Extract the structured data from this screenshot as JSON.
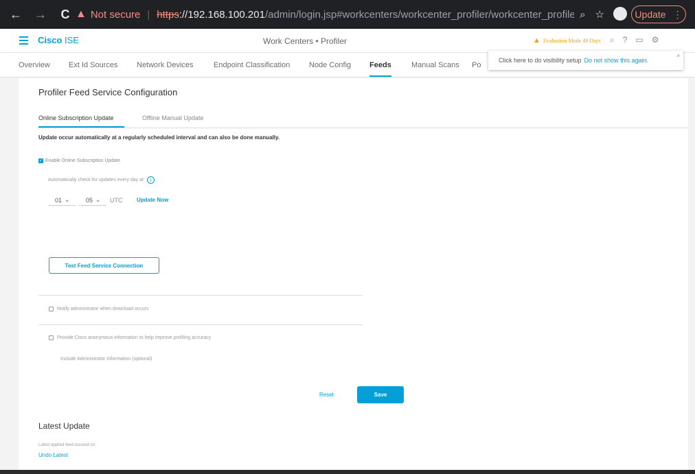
{
  "browser": {
    "back": "←",
    "forward": "→",
    "reload": "C",
    "not_secure": "Not secure",
    "separator": "|",
    "url_scheme": "https",
    "url_host": "://192.168.100.201",
    "url_path": "/admin/login.jsp#workcenters/workcenter_profiler/workcenter_profiler_...",
    "update_label": "Update"
  },
  "app": {
    "brand_bold": "Cisco",
    "brand_rest": " ISE",
    "page_title": "Work Centers • Profiler",
    "evaluation": "Evaluation Mode 49 Days"
  },
  "tabs": [
    "Overview",
    "Ext Id Sources",
    "Network Devices",
    "Endpoint Classification",
    "Node Config",
    "Feeds",
    "Manual Scans",
    "Po"
  ],
  "tooltip": {
    "text": "Click here to do visibility setup",
    "link": "Do not show this again.",
    "close": "×"
  },
  "section": {
    "title": "Profiler Feed Service Configuration",
    "subtabs": [
      "Online Subscription Update",
      "Offline Manual Update"
    ],
    "description": "Update occur automatically at a regularly scheduled interval and can also be done manually.",
    "enable_label": "Enable Online Subscription Update",
    "enable_checked": true,
    "auto_check": "Automatically check for updates every day at",
    "hour": "01",
    "minute": "05",
    "utc": "UTC",
    "update_now": "Update Now",
    "test_button": "Test Feed Service Connection",
    "notify_label": "Notify administrator when download occurs",
    "provide_label": "Provide Cisco anonymous information to help improve profiling accuracy",
    "include_label": "Include Administrator Information (optional)",
    "reset": "Reset",
    "save": "Save"
  },
  "latest": {
    "title": "Latest Update",
    "text": "Latest applied feed occured on:",
    "undo": "Undo Latest"
  }
}
